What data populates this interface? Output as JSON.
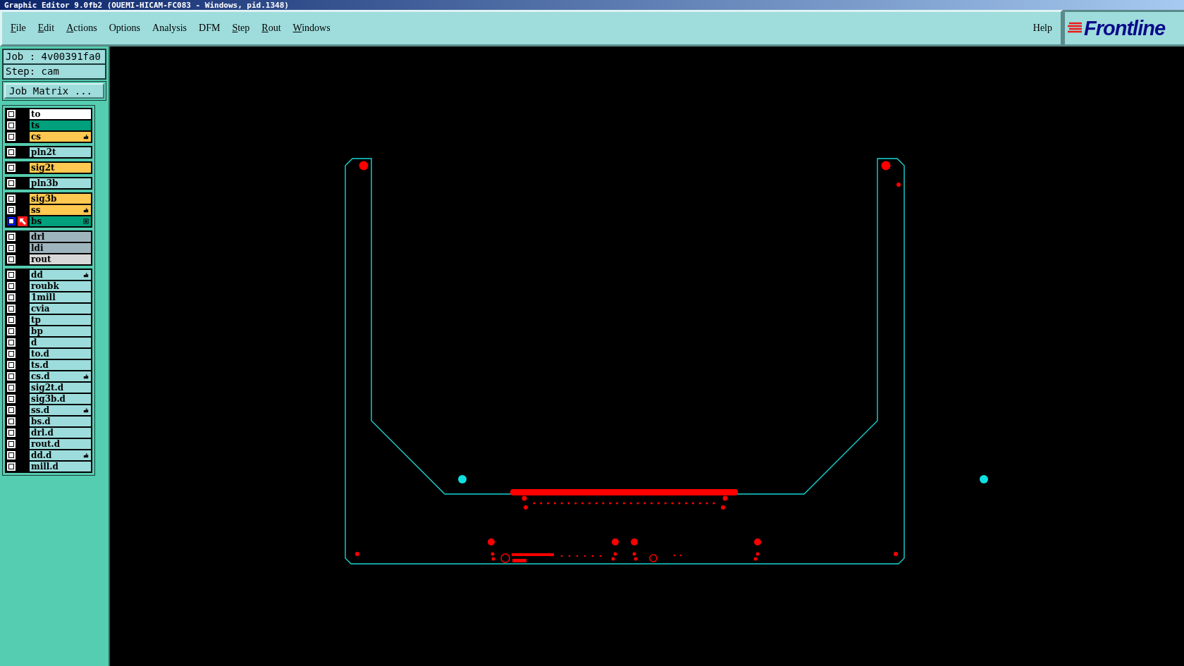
{
  "window": {
    "title": "Graphic Editor 9.0fb2 (OUEMI-HICAM-FC083 - Windows, pid.1348)"
  },
  "menu": [
    {
      "label": "File",
      "underline": true
    },
    {
      "label": "Edit",
      "underline": true
    },
    {
      "label": "Actions",
      "underline": true
    },
    {
      "label": "Options",
      "underline": false
    },
    {
      "label": "Analysis",
      "underline": false
    },
    {
      "label": "DFM",
      "underline": false
    },
    {
      "label": "Step",
      "underline": true
    },
    {
      "label": "Rout",
      "underline": true
    },
    {
      "label": "Windows",
      "underline": true
    }
  ],
  "help": "Help",
  "logo": "Frontline",
  "job": {
    "job_label": "Job : 4v00391fa0",
    "step_label": "Step: cam",
    "matrix_button": "Job Matrix ..."
  },
  "layer_groups": [
    {
      "layers": [
        {
          "name": "to",
          "color": "#ffffff",
          "checked": false,
          "hand": false,
          "grid": false,
          "work": false
        },
        {
          "name": "ts",
          "color": "#00a07c",
          "checked": false,
          "hand": false,
          "grid": false,
          "work": false
        },
        {
          "name": "cs",
          "color": "#ffc850",
          "checked": false,
          "hand": true,
          "grid": false,
          "work": false
        }
      ]
    },
    {
      "layers": [
        {
          "name": "pln2t",
          "color": "#9ddcdc",
          "checked": false,
          "hand": false,
          "grid": false,
          "work": false
        }
      ]
    },
    {
      "layers": [
        {
          "name": "sig2t",
          "color": "#ffc850",
          "checked": false,
          "hand": false,
          "grid": false,
          "work": false
        }
      ]
    },
    {
      "layers": [
        {
          "name": "pln3b",
          "color": "#9ddcdc",
          "checked": false,
          "hand": false,
          "grid": false,
          "work": false
        }
      ]
    },
    {
      "layers": [
        {
          "name": "sig3b",
          "color": "#ffc850",
          "checked": false,
          "hand": false,
          "grid": false,
          "work": false
        },
        {
          "name": "ss",
          "color": "#ffc850",
          "checked": false,
          "hand": true,
          "grid": false,
          "work": false
        },
        {
          "name": "bs",
          "color": "#00a07c",
          "checked": false,
          "hand": false,
          "grid": true,
          "work": true
        }
      ]
    },
    {
      "layers": [
        {
          "name": "drl",
          "color": "#9fb5be",
          "checked": false,
          "hand": false,
          "grid": false,
          "work": false
        },
        {
          "name": "ldi",
          "color": "#9fb5be",
          "checked": false,
          "hand": false,
          "grid": false,
          "work": false
        },
        {
          "name": "rout",
          "color": "#d8d8d8",
          "checked": false,
          "hand": false,
          "grid": false,
          "work": false
        }
      ]
    },
    {
      "layers": [
        {
          "name": "dd",
          "color": "#9ddcdc",
          "checked": false,
          "hand": true,
          "grid": false,
          "work": false
        },
        {
          "name": "roubk",
          "color": "#9ddcdc",
          "checked": false,
          "hand": false,
          "grid": false,
          "work": false
        },
        {
          "name": "1mill",
          "color": "#9ddcdc",
          "checked": false,
          "hand": false,
          "grid": false,
          "work": false
        },
        {
          "name": "cvia",
          "color": "#9ddcdc",
          "checked": false,
          "hand": false,
          "grid": false,
          "work": false
        },
        {
          "name": "tp",
          "color": "#9ddcdc",
          "checked": false,
          "hand": false,
          "grid": false,
          "work": false
        },
        {
          "name": "bp",
          "color": "#9ddcdc",
          "checked": false,
          "hand": false,
          "grid": false,
          "work": false
        },
        {
          "name": "d",
          "color": "#9ddcdc",
          "checked": false,
          "hand": false,
          "grid": false,
          "work": false
        },
        {
          "name": "to.d",
          "color": "#9ddcdc",
          "checked": false,
          "hand": false,
          "grid": false,
          "work": false
        },
        {
          "name": "ts.d",
          "color": "#9ddcdc",
          "checked": false,
          "hand": false,
          "grid": false,
          "work": false
        },
        {
          "name": "cs.d",
          "color": "#9ddcdc",
          "checked": false,
          "hand": true,
          "grid": false,
          "work": false
        },
        {
          "name": "sig2t.d",
          "color": "#9ddcdc",
          "checked": false,
          "hand": false,
          "grid": false,
          "work": false
        },
        {
          "name": "sig3b.d",
          "color": "#9ddcdc",
          "checked": false,
          "hand": false,
          "grid": false,
          "work": false
        },
        {
          "name": "ss.d",
          "color": "#9ddcdc",
          "checked": false,
          "hand": true,
          "grid": false,
          "work": false
        },
        {
          "name": "bs.d",
          "color": "#9ddcdc",
          "checked": false,
          "hand": false,
          "grid": false,
          "work": false
        },
        {
          "name": "drl.d",
          "color": "#9ddcdc",
          "checked": false,
          "hand": false,
          "grid": false,
          "work": false
        },
        {
          "name": "rout.d",
          "color": "#9ddcdc",
          "checked": false,
          "hand": false,
          "grid": false,
          "work": false
        },
        {
          "name": "dd.d",
          "color": "#9ddcdc",
          "checked": false,
          "hand": true,
          "grid": false,
          "work": false
        },
        {
          "name": "mill.d",
          "color": "#9ddcdc",
          "checked": false,
          "hand": false,
          "grid": false,
          "work": false
        }
      ]
    }
  ]
}
